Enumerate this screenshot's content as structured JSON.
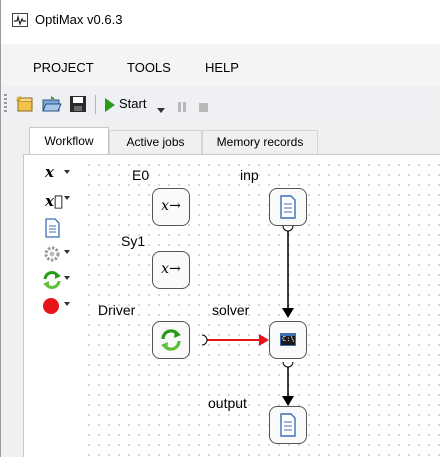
{
  "window": {
    "title": "OptiMax v0.6.3"
  },
  "menu": {
    "project": "PROJECT",
    "tools": "TOOLS",
    "help": "HELP"
  },
  "toolbar": {
    "start_label": "Start"
  },
  "tabs": [
    {
      "label": "Workflow",
      "active": true
    },
    {
      "label": "Active jobs",
      "active": false
    },
    {
      "label": "Memory records",
      "active": false
    }
  ],
  "palette": {
    "items": [
      "scalar-variable-icon",
      "vector-variable-icon",
      "file-icon",
      "gear-icon",
      "loop-icon",
      "stop-icon"
    ],
    "scalar_symbol": "x",
    "vector_symbol": "x⃗"
  },
  "workflow": {
    "nodes": [
      {
        "id": "E0",
        "label": "E0",
        "type": "variable",
        "symbol": "x→"
      },
      {
        "id": "Sy1",
        "label": "Sy1",
        "type": "variable",
        "symbol": "x→"
      },
      {
        "id": "Driver",
        "label": "Driver",
        "type": "driver"
      },
      {
        "id": "inp",
        "label": "inp",
        "type": "file"
      },
      {
        "id": "solver",
        "label": "solver",
        "type": "solver",
        "symbol": "C:\\"
      },
      {
        "id": "output",
        "label": "output",
        "type": "file"
      }
    ],
    "connections": [
      {
        "from": "inp",
        "to": "solver",
        "color": "#000000"
      },
      {
        "from": "Driver",
        "to": "solver",
        "color": "#e8141a"
      },
      {
        "from": "solver",
        "to": "output",
        "color": "#000000"
      }
    ]
  },
  "colors": {
    "accent_green": "#2a9a1a",
    "red_stop": "#e8141a",
    "file_blue": "#3b6fb8"
  }
}
